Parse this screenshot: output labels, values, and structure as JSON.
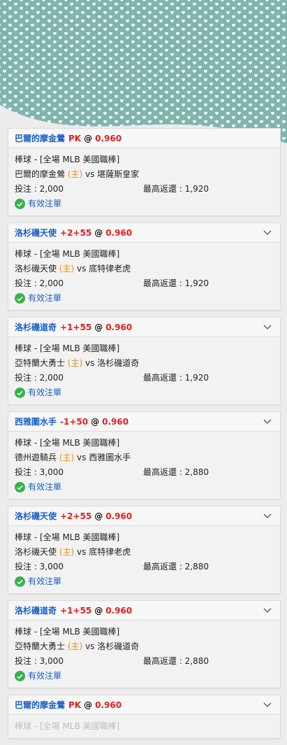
{
  "colors": {
    "pattern_bg": "#7fb5ad",
    "team_title": "#1a5fc8",
    "handicap_odds": "#e0201f",
    "home_tag": "#f08c12",
    "valid_check": "#37b24d"
  },
  "icons": {
    "expand": "chevron-down-icon",
    "valid": "check-circle-icon"
  },
  "bets": [
    {
      "title_team": "巴爾的摩金鶯",
      "title_handicap": "PK",
      "title_at": "@",
      "title_odds": "0.960",
      "league": "棒球 - [全場 MLB 美國職棒]",
      "home_team": "巴爾的摩金鶯",
      "home_tag": "(主)",
      "vs": "vs",
      "away_team": "堪薩斯皇家",
      "stake_label": "投注 : 2,000",
      "max_return_label": "最高返還 : 1,920",
      "status": "有效注單",
      "show_chevron": false
    },
    {
      "title_team": "洛杉磯天使",
      "title_handicap": "+2+55",
      "title_at": "@",
      "title_odds": "0.960",
      "league": "棒球 - [全場 MLB 美國職棒]",
      "home_team": "洛杉磯天使",
      "home_tag": "(主)",
      "vs": "vs",
      "away_team": "底特律老虎",
      "stake_label": "投注 : 2,000",
      "max_return_label": "最高返還 : 1,920",
      "status": "有效注單",
      "show_chevron": true
    },
    {
      "title_team": "洛杉磯道奇",
      "title_handicap": "+1+55",
      "title_at": "@",
      "title_odds": "0.960",
      "league": "棒球 - [全場 MLB 美國職棒]",
      "home_team": "亞特蘭大勇士",
      "home_tag": "(主)",
      "vs": "vs",
      "away_team": "洛杉磯道奇",
      "stake_label": "投注 : 2,000",
      "max_return_label": "最高返還 : 1,920",
      "status": "有效注單",
      "show_chevron": true
    },
    {
      "title_team": "西雅圖水手",
      "title_handicap": "-1+50",
      "title_at": "@",
      "title_odds": "0.960",
      "league": "棒球 - [全場 MLB 美國職棒]",
      "home_team": "德州遊騎兵",
      "home_tag": "(主)",
      "vs": "vs",
      "away_team": "西雅圖水手",
      "stake_label": "投注 : 3,000",
      "max_return_label": "最高返還 : 2,880",
      "status": "有效注單",
      "show_chevron": true
    },
    {
      "title_team": "洛杉磯天使",
      "title_handicap": "+2+55",
      "title_at": "@",
      "title_odds": "0.960",
      "league": "棒球 - [全場 MLB 美國職棒]",
      "home_team": "洛杉磯天使",
      "home_tag": "(主)",
      "vs": "vs",
      "away_team": "底特律老虎",
      "stake_label": "投注 : 3,000",
      "max_return_label": "最高返還 : 2,880",
      "status": "有效注單",
      "show_chevron": true
    },
    {
      "title_team": "洛杉磯道奇",
      "title_handicap": "+1+55",
      "title_at": "@",
      "title_odds": "0.960",
      "league": "棒球 - [全場 MLB 美國職棒]",
      "home_team": "亞特蘭大勇士",
      "home_tag": "(主)",
      "vs": "vs",
      "away_team": "洛杉磯道奇",
      "stake_label": "投注 : 3,000",
      "max_return_label": "最高返還 : 2,880",
      "status": "有效注單",
      "show_chevron": true
    },
    {
      "title_team": "巴爾的摩金鶯",
      "title_handicap": "PK",
      "title_at": "@",
      "title_odds": "0.960",
      "league": "棒球 - [全場 MLB 美國職棒]",
      "home_team": "",
      "home_tag": "",
      "vs": "",
      "away_team": "",
      "stake_label": "",
      "max_return_label": "",
      "status": "",
      "show_chevron": true
    }
  ]
}
